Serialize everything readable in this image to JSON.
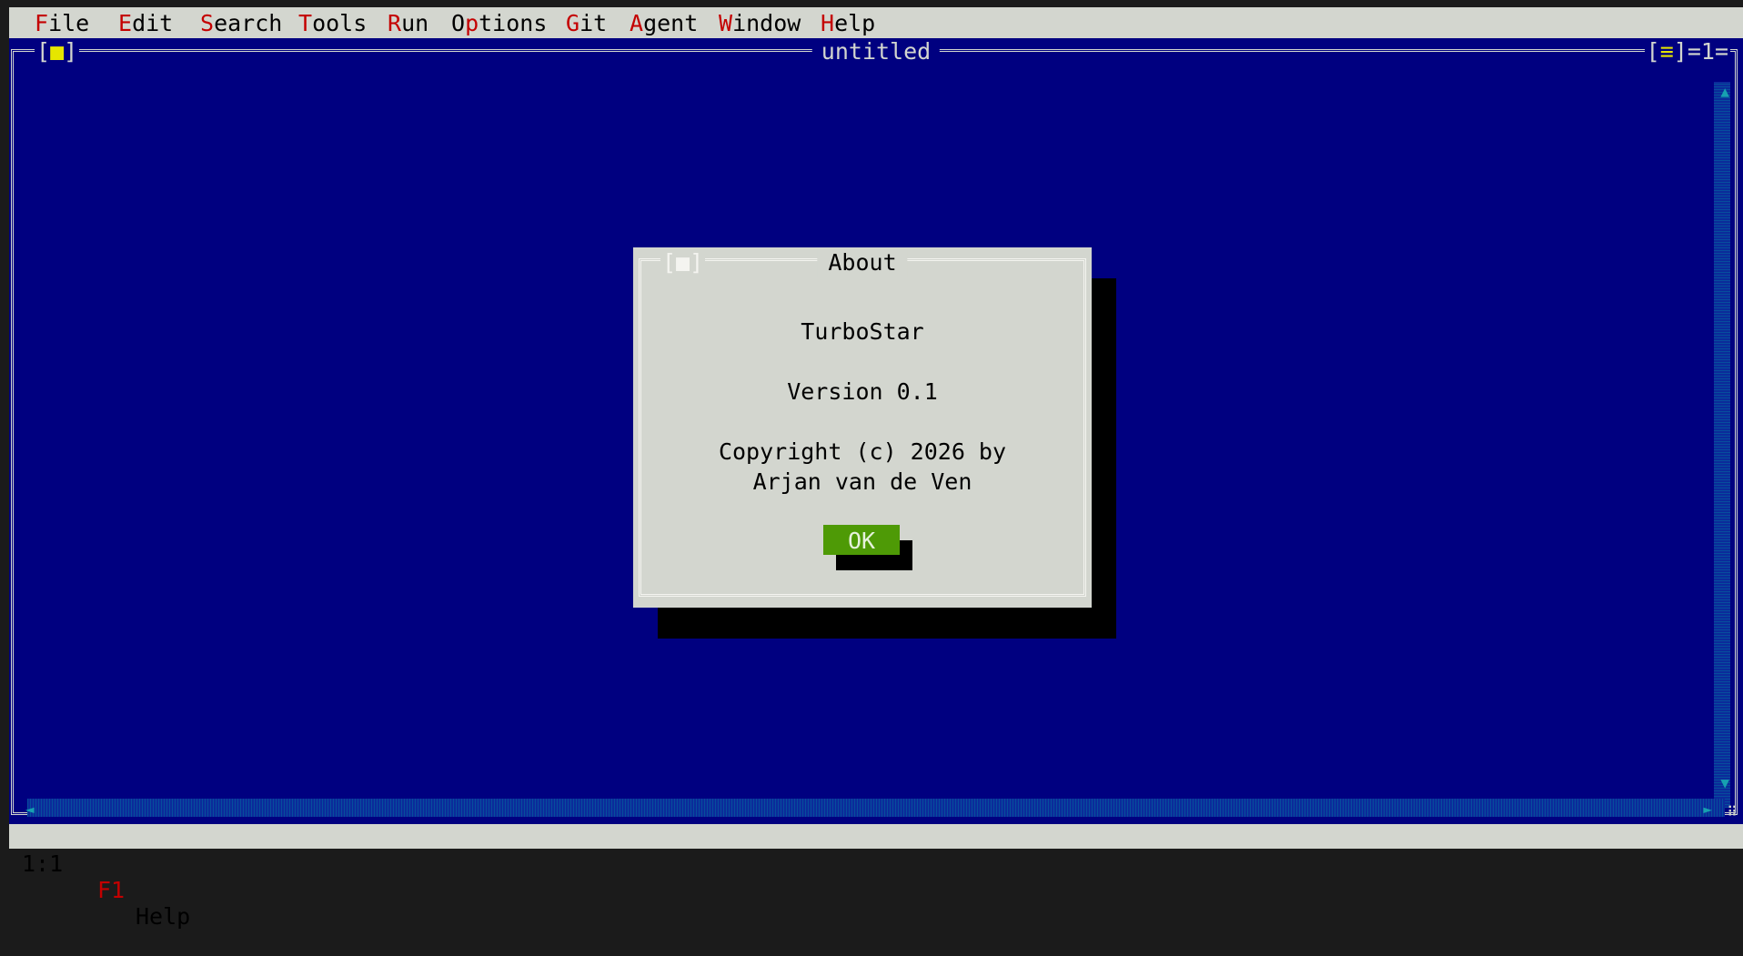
{
  "menubar": {
    "items": [
      {
        "hot": "F",
        "rest": "ile"
      },
      {
        "hot": "E",
        "rest": "dit"
      },
      {
        "hot": "S",
        "rest": "earch"
      },
      {
        "hot": "T",
        "rest": "ools"
      },
      {
        "hot": "R",
        "rest": "un"
      },
      {
        "pre": "O",
        "hot": "p",
        "rest": "tions"
      },
      {
        "hot": "G",
        "rest": "it"
      },
      {
        "hot": "A",
        "rest": "gent"
      },
      {
        "hot": "W",
        "rest": "indow"
      },
      {
        "hot": "H",
        "rest": "elp"
      }
    ]
  },
  "editor": {
    "title": "untitled",
    "close_glyph": "■",
    "close_open": "[",
    "close_end": "]",
    "zoom_glyph": "≡",
    "window_number": "=1=",
    "arrow_up": "▲",
    "arrow_down": "▼",
    "arrow_left": "◄",
    "arrow_right": "►",
    "resize_grip": "⠿"
  },
  "dialog": {
    "title": "About",
    "close_text": "[■]",
    "app_name": "TurboStar",
    "version": "Version 0.1",
    "copyright": "Copyright (c) 2026 by",
    "author": "Arjan van de Ven",
    "ok_label": "OK"
  },
  "statusbar": {
    "position": "1:1",
    "help_key": "F1",
    "help_label": "Help"
  },
  "colors": {
    "desktop": "#000080",
    "menu_bg": "#d3d6cf",
    "hotkey": "#c40000",
    "ok_button": "#4e9a06",
    "scroll_arrow": "#17a0b0",
    "window_glyph": "#e6e600"
  }
}
